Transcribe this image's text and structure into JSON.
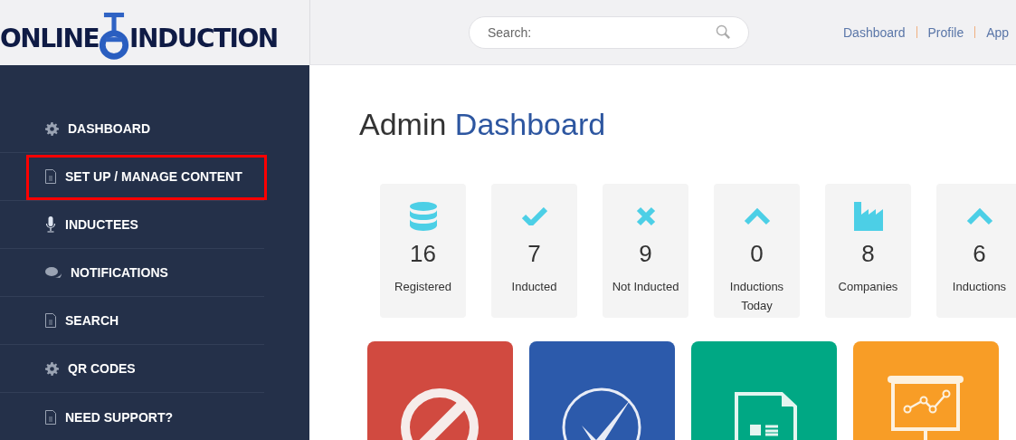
{
  "logo": {
    "left": "ONLINE",
    "right": "INDUCTION"
  },
  "search": {
    "placeholder": "Search:"
  },
  "top_links": [
    "Dashboard",
    "Profile",
    "App"
  ],
  "sidebar": {
    "items": [
      {
        "label": "DASHBOARD",
        "kind": "gear",
        "highlighted": false
      },
      {
        "label": "SET UP / MANAGE CONTENT",
        "kind": "doc",
        "highlighted": true
      },
      {
        "label": "INDUCTEES",
        "kind": "mic",
        "highlighted": false
      },
      {
        "label": "NOTIFICATIONS",
        "kind": "chat",
        "highlighted": false
      },
      {
        "label": "SEARCH",
        "kind": "doc",
        "highlighted": false
      },
      {
        "label": "QR CODES",
        "kind": "gear",
        "highlighted": false
      },
      {
        "label": "NEED SUPPORT?",
        "kind": "doc",
        "highlighted": false
      }
    ]
  },
  "title": {
    "plain": "Admin",
    "accent": "Dashboard"
  },
  "stats": [
    {
      "kind": "database",
      "value": "16",
      "label": "Registered"
    },
    {
      "kind": "check",
      "value": "7",
      "label": "Inducted"
    },
    {
      "kind": "cross",
      "value": "9",
      "label": "Not Inducted"
    },
    {
      "kind": "chevron",
      "value": "0",
      "label": "Inductions Today"
    },
    {
      "kind": "factory",
      "value": "8",
      "label": "Companies"
    },
    {
      "kind": "chevron",
      "value": "6",
      "label": "Inductions"
    }
  ],
  "tiles": [
    {
      "kind": "ban",
      "color": "#d14a40"
    },
    {
      "kind": "check-circle",
      "color": "#2c5aab"
    },
    {
      "kind": "form",
      "color": "#00a884"
    },
    {
      "kind": "presentation",
      "color": "#f89d26"
    }
  ]
}
